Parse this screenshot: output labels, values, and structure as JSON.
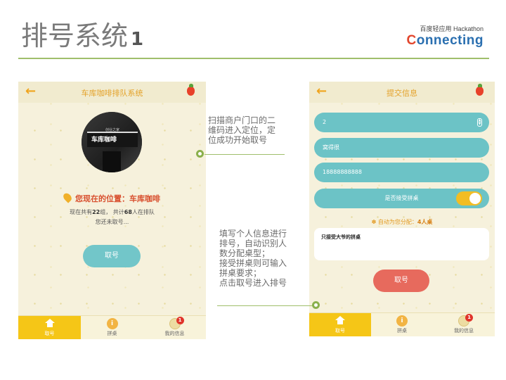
{
  "slide": {
    "title": "排号系统",
    "title_number": "1",
    "brand_small": "百度轻应用 Hackathon",
    "brand_logo_first": "C",
    "brand_logo_rest": "onnecting"
  },
  "screen1": {
    "title": "车库咖啡排队系统",
    "avatar_sign": "车库咖啡",
    "avatar_sub": "创业之家",
    "location_prefix": "您现在的位置：",
    "location_name": "车库咖啡",
    "count_a": "现在共有",
    "groups": "22",
    "count_b": "组， 共计",
    "people": "68",
    "count_c": "人在排队",
    "status": "您还未取号...",
    "take_button": "取号"
  },
  "screen2": {
    "title": "提交信息",
    "field_people": "2",
    "field_name": "窝得很",
    "field_phone": "18888888888",
    "share_label": "是否接受拼桌",
    "auto_prefix": "自动为您分配：",
    "auto_value": "4人桌",
    "remark": "只接受大爷的拼桌",
    "take_button": "取号"
  },
  "tabs": [
    {
      "label": "取号",
      "icon": "home-icon"
    },
    {
      "label": "拼桌",
      "icon": "coin-icon",
      "glyph": "i"
    },
    {
      "label": "我的信息",
      "icon": "globe-icon",
      "badge": "1"
    }
  ],
  "callouts": {
    "first": [
      "扫描商户门口的二",
      "维码进入定位，定",
      "位成功开始取号"
    ],
    "second": [
      "填写个人信息进行",
      "排号，自动识别人",
      "数分配桌型；",
      "接受拼桌则可输入",
      "拼桌要求；",
      "点击取号进入排号"
    ]
  },
  "colors": {
    "accent_teal": "#72c6c9",
    "accent_yellow": "#f5c617",
    "accent_red": "#e76a5d",
    "rule_green": "#9fbf6b"
  }
}
